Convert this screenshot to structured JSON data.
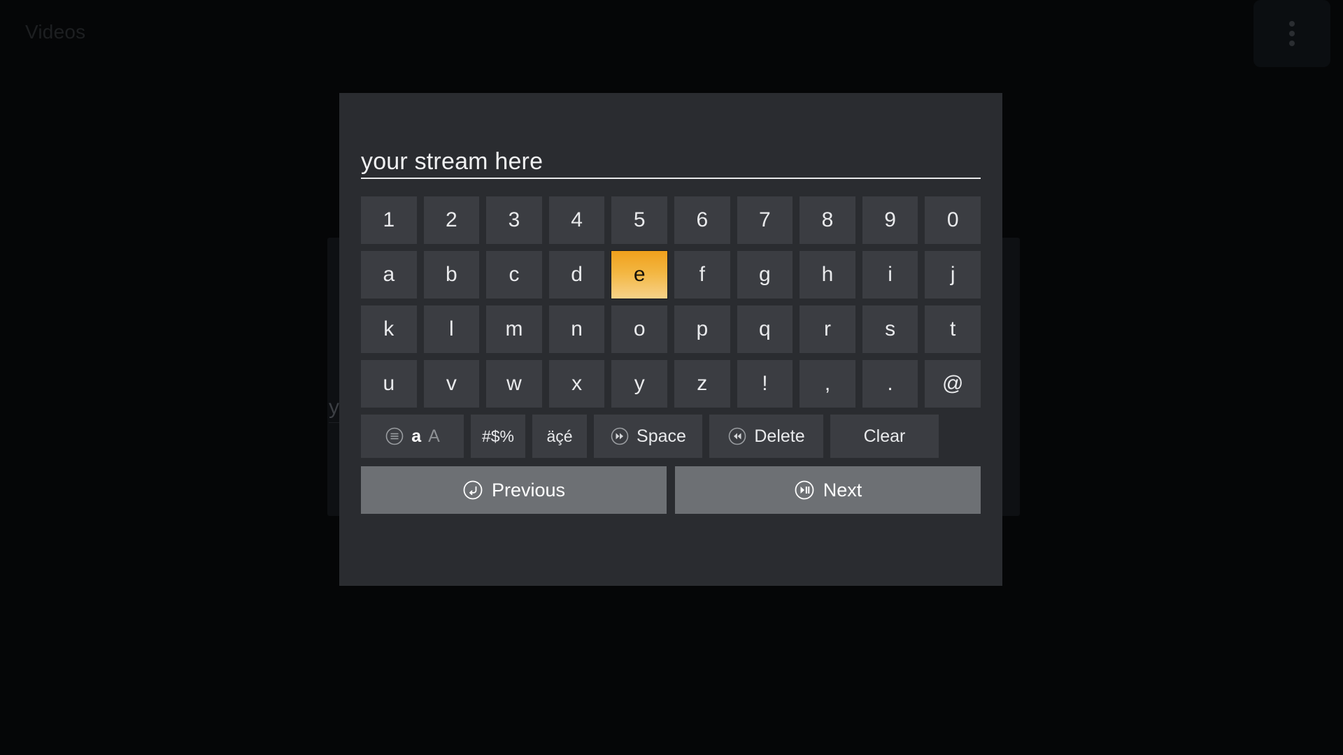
{
  "background": {
    "app_title": "Videos",
    "menu_icon": "kebab-menu-icon",
    "ghost_field_text": "y"
  },
  "keyboard": {
    "input": {
      "value": "your stream here",
      "placeholder": "your stream here"
    },
    "rows": [
      {
        "keys": [
          {
            "label": "1",
            "selected": false
          },
          {
            "label": "2",
            "selected": false
          },
          {
            "label": "3",
            "selected": false
          },
          {
            "label": "4",
            "selected": false
          },
          {
            "label": "5",
            "selected": false
          },
          {
            "label": "6",
            "selected": false
          },
          {
            "label": "7",
            "selected": false
          },
          {
            "label": "8",
            "selected": false
          },
          {
            "label": "9",
            "selected": false
          },
          {
            "label": "0",
            "selected": false
          }
        ]
      },
      {
        "keys": [
          {
            "label": "a",
            "selected": false
          },
          {
            "label": "b",
            "selected": false
          },
          {
            "label": "c",
            "selected": false
          },
          {
            "label": "d",
            "selected": false
          },
          {
            "label": "e",
            "selected": true
          },
          {
            "label": "f",
            "selected": false
          },
          {
            "label": "g",
            "selected": false
          },
          {
            "label": "h",
            "selected": false
          },
          {
            "label": "i",
            "selected": false
          },
          {
            "label": "j",
            "selected": false
          }
        ]
      },
      {
        "keys": [
          {
            "label": "k",
            "selected": false
          },
          {
            "label": "l",
            "selected": false
          },
          {
            "label": "m",
            "selected": false
          },
          {
            "label": "n",
            "selected": false
          },
          {
            "label": "o",
            "selected": false
          },
          {
            "label": "p",
            "selected": false
          },
          {
            "label": "q",
            "selected": false
          },
          {
            "label": "r",
            "selected": false
          },
          {
            "label": "s",
            "selected": false
          },
          {
            "label": "t",
            "selected": false
          }
        ]
      },
      {
        "keys": [
          {
            "label": "u",
            "selected": false
          },
          {
            "label": "v",
            "selected": false
          },
          {
            "label": "w",
            "selected": false
          },
          {
            "label": "x",
            "selected": false
          },
          {
            "label": "y",
            "selected": false
          },
          {
            "label": "z",
            "selected": false
          },
          {
            "label": "!",
            "selected": false
          },
          {
            "label": ",",
            "selected": false
          },
          {
            "label": ".",
            "selected": false
          },
          {
            "label": "@",
            "selected": false
          }
        ]
      }
    ],
    "function_row": {
      "case_toggle": {
        "icon": "menu-circle-icon",
        "lower": "a",
        "upper": "A"
      },
      "symbols": {
        "label": "#$%"
      },
      "accents": {
        "label": "äçé"
      },
      "space": {
        "icon": "fast-forward-circle-icon",
        "label": "Space"
      },
      "delete": {
        "icon": "rewind-circle-icon",
        "label": "Delete"
      },
      "clear": {
        "label": "Clear"
      }
    },
    "nav": {
      "previous": {
        "icon": "back-circle-icon",
        "label": "Previous"
      },
      "next": {
        "icon": "play-pause-circle-icon",
        "label": "Next"
      }
    }
  },
  "colors": {
    "page_background": "#050607",
    "modal_background": "#2a2c30",
    "key_background": "#3b3d42",
    "key_text": "#e9eaec",
    "selected_key_top": "#f0a01c",
    "selected_key_bottom": "#f7d28a",
    "selected_key_text": "#17130a",
    "nav_button_background": "#6d7074",
    "input_underline": "#e8e9ea"
  }
}
